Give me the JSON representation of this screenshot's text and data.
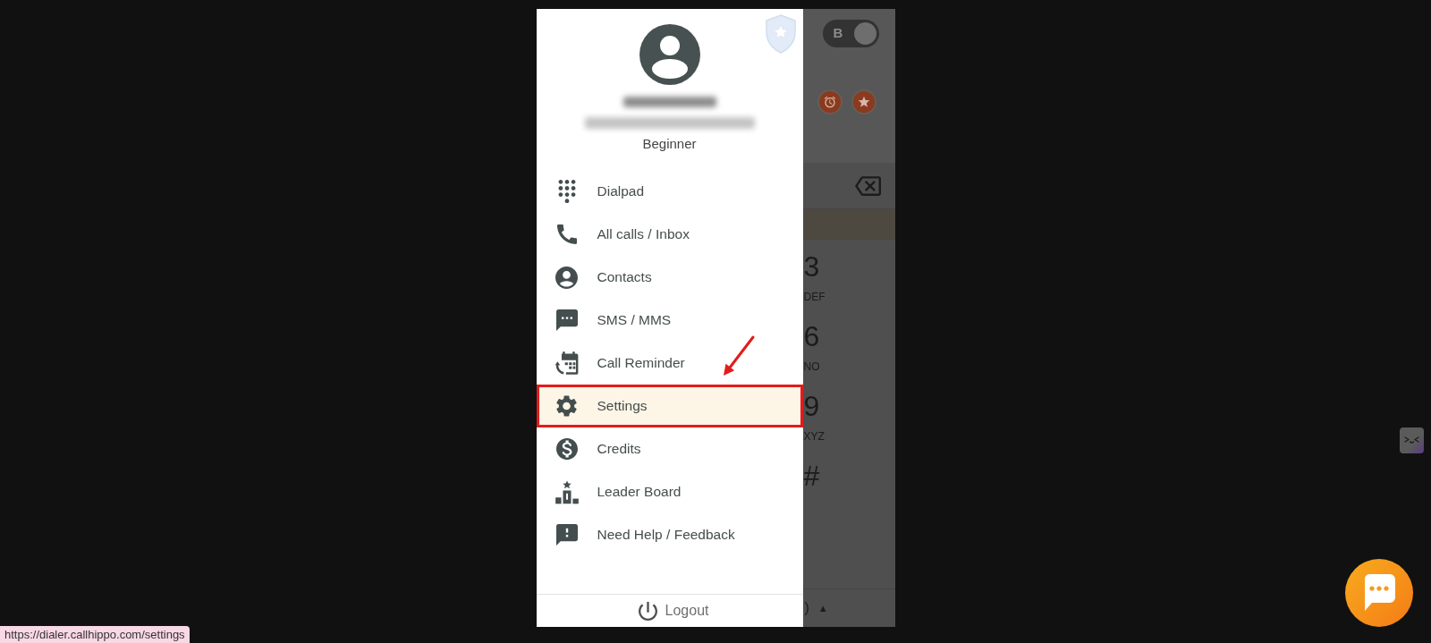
{
  "drawer": {
    "profile": {
      "rank": "Beginner"
    },
    "menu": [
      {
        "label": "Dialpad",
        "selected": false,
        "marked": false
      },
      {
        "label": "All calls / Inbox",
        "selected": false,
        "marked": false
      },
      {
        "label": "Contacts",
        "selected": false,
        "marked": false
      },
      {
        "label": "SMS / MMS",
        "selected": false,
        "marked": false
      },
      {
        "label": "Call Reminder",
        "selected": false,
        "marked": false
      },
      {
        "label": "Settings",
        "selected": true,
        "marked": true
      },
      {
        "label": "Credits",
        "selected": false,
        "marked": false
      },
      {
        "label": "Leader Board",
        "selected": false,
        "marked": false
      },
      {
        "label": "Need Help / Feedback",
        "selected": false,
        "marked": false
      }
    ],
    "logout": {
      "label": "Logout"
    }
  },
  "dialer": {
    "mode_toggle": {
      "label": "B",
      "on": true
    },
    "keypad": [
      {
        "digit": "3",
        "letters": "DEF"
      },
      {
        "digit": "6",
        "letters": "NO"
      },
      {
        "digit": "9",
        "letters": "XYZ"
      },
      {
        "digit": "#"
      }
    ],
    "footer": {
      "text": ")",
      "caret": "▲"
    }
  },
  "status_url": "https://dialer.callhippo.com/settings"
}
